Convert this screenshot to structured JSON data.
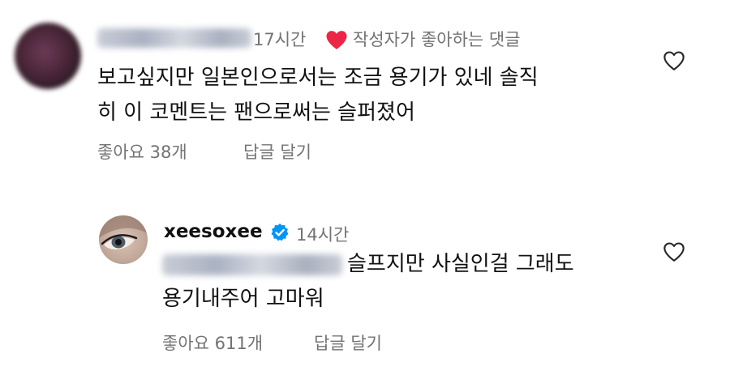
{
  "comment1": {
    "time": "17시간",
    "liked_by_author": "작성자가 좋아하는 댓글",
    "text_line1": "보고싶지만 일본인으로서는 조금 용기가 있네 솔직",
    "text_line2": "히 이 코멘트는 팬으로써는 슬퍼졌어",
    "likes": "좋아요 38개",
    "reply": "답글 달기"
  },
  "reply1": {
    "username": "xeesoxee",
    "time": "14시간",
    "text_line1": "슬프지만 사실인걸 그래도",
    "text_line2": "용기내주어 고마워",
    "likes": "좋아요 611개",
    "reply": "답글 달기"
  },
  "colors": {
    "liked_heart": "#ed2547",
    "verified": "#0095f6",
    "secondary_text": "#737373"
  }
}
